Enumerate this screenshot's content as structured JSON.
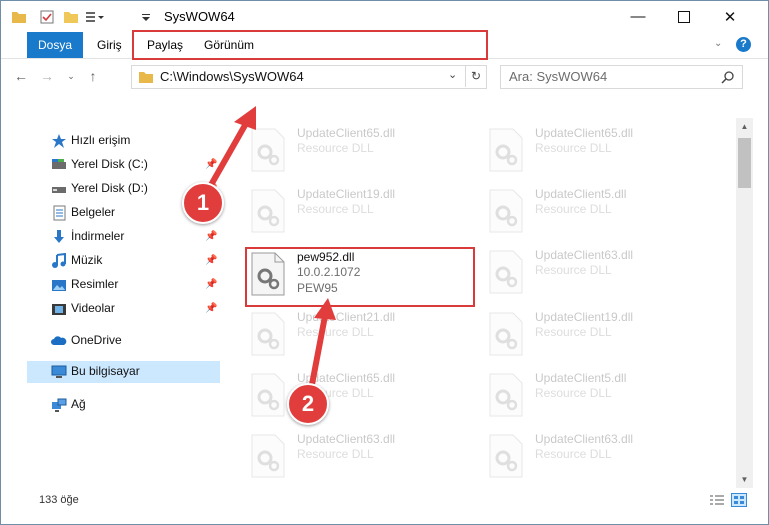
{
  "window": {
    "title": "SysWOW64",
    "minimize_icon": "minimize-icon",
    "maximize_icon": "maximize-icon",
    "close_icon": "close-icon"
  },
  "ribbon": {
    "tabs": [
      "Dosya",
      "Giriş",
      "Paylaş",
      "Görünüm"
    ],
    "help_label": "?"
  },
  "address_bar": {
    "path": "C:\\Windows\\SysWOW64",
    "search_placeholder": "Ara: SysWOW64"
  },
  "navigation": {
    "items": [
      {
        "label": "Hızlı erişim",
        "icon": "star-icon"
      },
      {
        "label": "Yerel Disk (C:)",
        "icon": "drive-icon",
        "pinned": true
      },
      {
        "label": "Yerel Disk (D:)",
        "icon": "drive-icon",
        "pinned": true
      },
      {
        "label": "Belgeler",
        "icon": "documents-icon",
        "pinned": true
      },
      {
        "label": "İndirmeler",
        "icon": "download-icon",
        "pinned": true
      },
      {
        "label": "Müzik",
        "icon": "music-icon",
        "pinned": true
      },
      {
        "label": "Resimler",
        "icon": "pictures-icon",
        "pinned": true
      },
      {
        "label": "Videolar",
        "icon": "videos-icon",
        "pinned": true
      },
      {
        "label": "OneDrive",
        "icon": "cloud-icon"
      },
      {
        "label": "Bu bilgisayar",
        "icon": "computer-icon",
        "selected": true
      },
      {
        "label": "Ağ",
        "icon": "network-icon"
      }
    ]
  },
  "files": {
    "left_column": [
      {
        "name": "UpdateClient65.dll",
        "desc": "Resource DLL"
      },
      {
        "name": "UpdateClient19.dll",
        "desc": "Resource DLL"
      },
      {
        "name": "pew952.dll",
        "version": "10.0.2.1072",
        "desc": "PEW95"
      },
      {
        "name": "UpdateClient21.dll",
        "desc": "Resource DLL"
      },
      {
        "name": "UpdateClient65.dll",
        "desc": "Resource DLL"
      },
      {
        "name": "UpdateClient63.dll",
        "desc": "Resource DLL"
      }
    ],
    "right_column": [
      {
        "name": "UpdateClient65.dll",
        "desc": "Resource DLL"
      },
      {
        "name": "UpdateClient5.dll",
        "desc": "Resource DLL"
      },
      {
        "name": "UpdateClient63.dll",
        "desc": "Resource DLL"
      },
      {
        "name": "UpdateClient19.dll",
        "desc": "Resource DLL"
      },
      {
        "name": "UpdateClient5.dll",
        "desc": "Resource DLL"
      },
      {
        "name": "UpdateClient63.dll",
        "desc": "Resource DLL"
      }
    ]
  },
  "status": {
    "item_count": "133 öğe"
  },
  "annotations": {
    "step1": "1",
    "step2": "2",
    "highlight_color": "#d93a3a"
  }
}
